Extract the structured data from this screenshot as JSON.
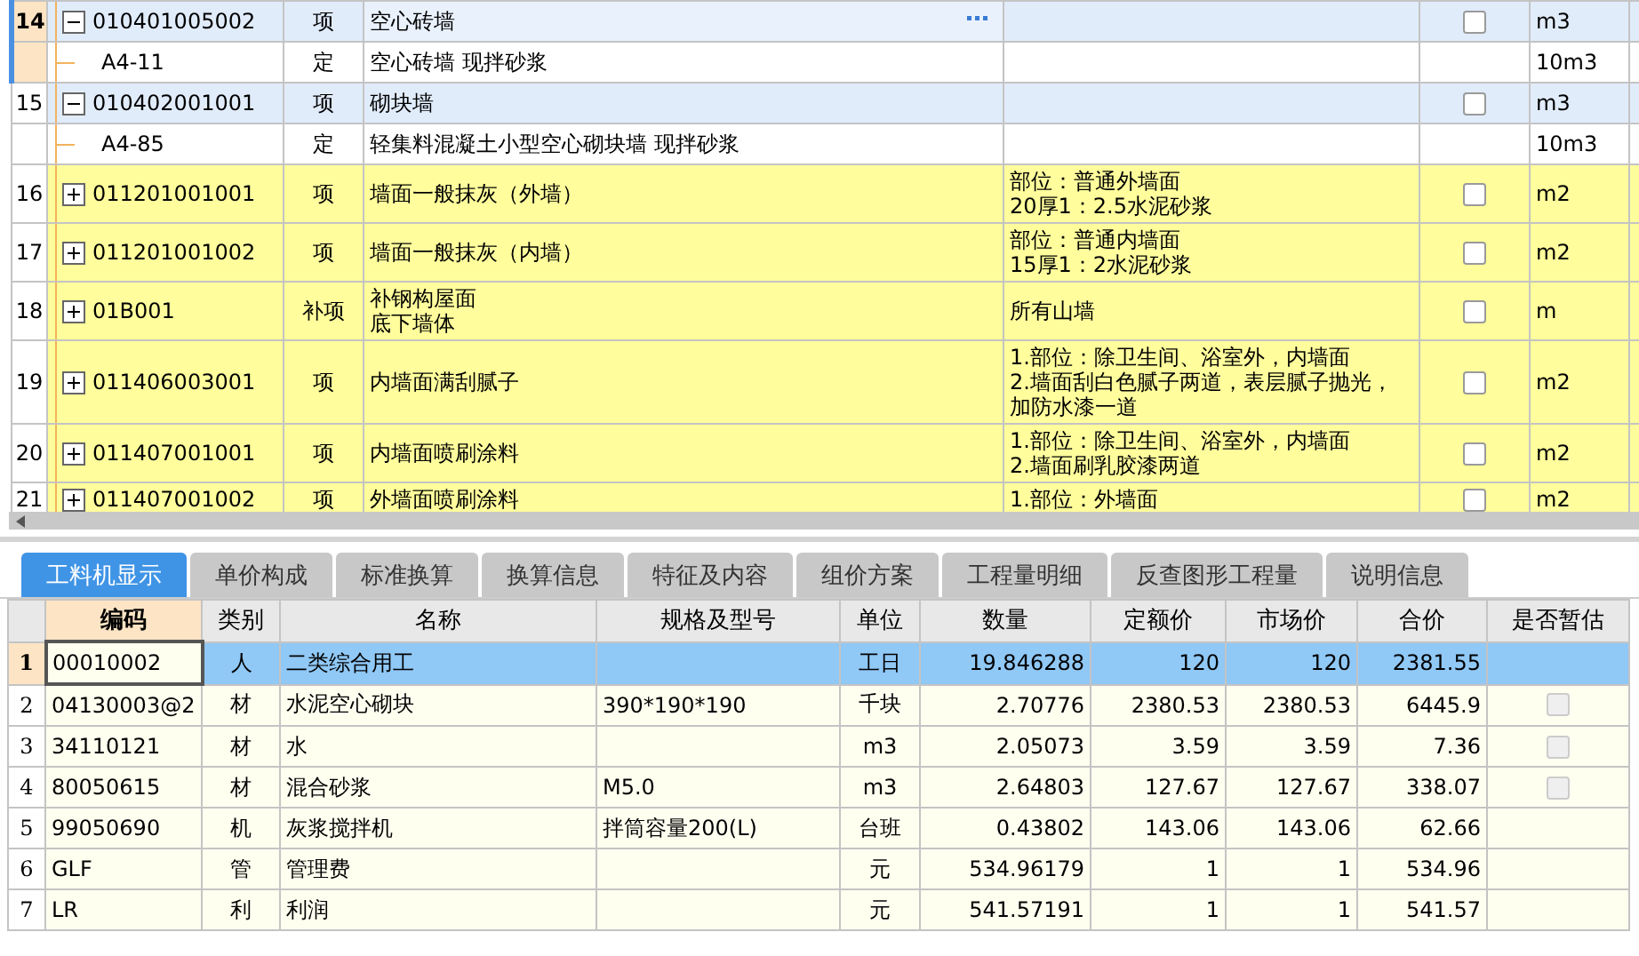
{
  "bill_rows": [
    {
      "number": "14",
      "code": "010401005002",
      "type": "项",
      "name": [
        "空心砖墙"
      ],
      "unit": "m3",
      "checked": false,
      "selected": true,
      "expanded": true,
      "children": [
        {
          "code": "A4-11",
          "type": "定",
          "name": "空心砖墙 现拌砂浆",
          "unit": "10m3"
        }
      ]
    },
    {
      "number": "15",
      "code": "010402001001",
      "type": "项",
      "name": [
        "砌块墙"
      ],
      "unit": "m3",
      "checked": false,
      "selected": false,
      "expanded": true,
      "children": [
        {
          "code": "A4-85",
          "type": "定",
          "name": "轻集料混凝土小型空心砌块墙 现拌砂浆",
          "unit": "10m3"
        }
      ]
    },
    {
      "number": "16",
      "code": "011201001001",
      "type": "项",
      "name": [
        "墙面一般抹灰（外墙）"
      ],
      "features": [
        "部位：普通外墙面",
        "20厚1：2.5水泥砂浆"
      ],
      "unit": "m2",
      "checked": false,
      "selected": false,
      "expanded": false
    },
    {
      "number": "17",
      "code": "011201001002",
      "type": "项",
      "name": [
        "墙面一般抹灰（内墙）"
      ],
      "features": [
        "部位：普通内墙面",
        "15厚1：2水泥砂浆"
      ],
      "unit": "m2",
      "checked": false,
      "selected": false,
      "expanded": false
    },
    {
      "number": "18",
      "code": "01B001",
      "type": "补项",
      "name": [
        "补钢构屋面",
        "底下墙体"
      ],
      "features": [
        "所有山墙"
      ],
      "unit": "m",
      "checked": false,
      "selected": false,
      "expanded": false
    },
    {
      "number": "19",
      "code": "011406003001",
      "type": "项",
      "name": [
        "内墙面满刮腻子"
      ],
      "features": [
        "1.部位：除卫生间、浴室外，内墙面",
        "2.墙面刮白色腻子两道，表层腻子抛光，",
        "加防水漆一道"
      ],
      "unit": "m2",
      "checked": false,
      "selected": false,
      "expanded": false
    },
    {
      "number": "20",
      "code": "011407001001",
      "type": "项",
      "name": [
        "内墙面喷刷涂料"
      ],
      "features": [
        "1.部位：除卫生间、浴室外，内墙面",
        "2.墙面刷乳胶漆两道"
      ],
      "unit": "m2",
      "checked": false,
      "selected": false,
      "expanded": false
    },
    {
      "number": "21",
      "code": "011407001002",
      "type": "项",
      "name": [
        "外墙面喷刷涂料"
      ],
      "features": [
        "1.部位：外墙面"
      ],
      "unit": "m2",
      "checked": false,
      "selected": false,
      "expanded": false
    }
  ],
  "detail_tabs": [
    {
      "label": "工料机显示",
      "selected": true
    },
    {
      "label": "单价构成",
      "selected": false
    },
    {
      "label": "标准换算",
      "selected": false
    },
    {
      "label": "换算信息",
      "selected": false
    },
    {
      "label": "特征及内容",
      "selected": false
    },
    {
      "label": "组价方案",
      "selected": false
    },
    {
      "label": "工程量明细",
      "selected": false
    },
    {
      "label": "反查图形工程量",
      "selected": false
    },
    {
      "label": "说明信息",
      "selected": false
    }
  ],
  "resource_table": {
    "columns": [
      "编码",
      "类别",
      "名称",
      "规格及型号",
      "单位",
      "数量",
      "定额价",
      "市场价",
      "合价",
      "是否暂估"
    ],
    "rows": [
      {
        "number": "1",
        "code": "00010002",
        "category": "人",
        "name": "二类综合用工",
        "unit": "工日",
        "quantity": "19.846288",
        "quota_price": "120",
        "market_price": "120",
        "total": "2381.55",
        "selected": true
      },
      {
        "number": "2",
        "code": "04130003@2",
        "category": "材",
        "name": "水泥空心砌块",
        "spec": "390*190*190",
        "unit": "千块",
        "quantity": "2.70776",
        "quota_price": "2380.53",
        "market_price": "2380.53",
        "total": "6445.9",
        "selected": false,
        "estimate": {
          "checked": false,
          "disabled": true
        }
      },
      {
        "number": "3",
        "code": "34110121",
        "category": "材",
        "name": "水",
        "unit": "m3",
        "quantity": "2.05073",
        "quota_price": "3.59",
        "market_price": "3.59",
        "total": "7.36",
        "selected": false,
        "estimate": {
          "checked": false,
          "disabled": true
        }
      },
      {
        "number": "4",
        "code": "80050615",
        "category": "材",
        "name": "混合砂浆",
        "spec": "M5.0",
        "unit": "m3",
        "quantity": "2.64803",
        "quota_price": "127.67",
        "market_price": "127.67",
        "total": "338.07",
        "selected": false,
        "estimate": {
          "checked": false,
          "disabled": true
        }
      },
      {
        "number": "5",
        "code": "99050690",
        "category": "机",
        "name": "灰浆搅拌机",
        "spec": "拌筒容量200(L)",
        "unit": "台班",
        "quantity": "0.43802",
        "quota_price": "143.06",
        "market_price": "143.06",
        "total": "62.66",
        "selected": false
      },
      {
        "number": "6",
        "code": "GLF",
        "category": "管",
        "name": "管理费",
        "unit": "元",
        "quantity": "534.96179",
        "quota_price": "1",
        "market_price": "1",
        "total": "534.96",
        "selected": false
      },
      {
        "number": "7",
        "code": "LR",
        "category": "利",
        "name": "利润",
        "unit": "元",
        "quantity": "541.57191",
        "quota_price": "1",
        "market_price": "1",
        "total": "541.57",
        "selected": false
      }
    ]
  }
}
